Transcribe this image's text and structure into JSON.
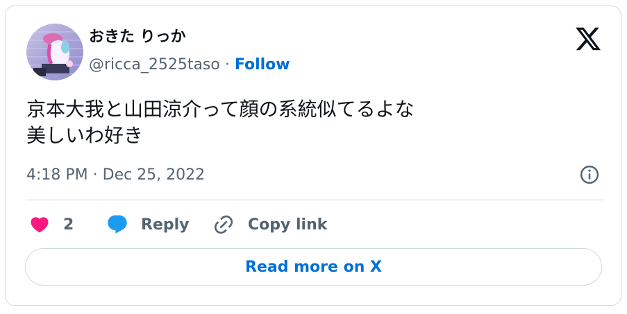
{
  "user": {
    "display_name": "おきた りっか",
    "handle": "@ricca_2525taso",
    "separator": " · ",
    "follow_label": "Follow"
  },
  "tweet": {
    "text_line1": "京本大我と山田涼介って顔の系統似てるよな",
    "text_line2": "美しいわ好き",
    "timestamp": "4:18 PM · Dec 25, 2022"
  },
  "actions": {
    "like_count": "2",
    "reply_label": "Reply",
    "copy_link_label": "Copy link"
  },
  "footer": {
    "read_more_label": "Read more on X"
  },
  "icons": {
    "brand": "x-logo-icon",
    "info": "info-icon",
    "like": "heart-icon",
    "reply": "speech-bubble-icon",
    "copy": "link-icon"
  },
  "colors": {
    "text_primary": "#0f1419",
    "text_secondary": "#536471",
    "link_blue": "#006fd6",
    "like_pink": "#f91880",
    "reply_blue": "#1d9bf0",
    "border": "#cfd9de"
  }
}
